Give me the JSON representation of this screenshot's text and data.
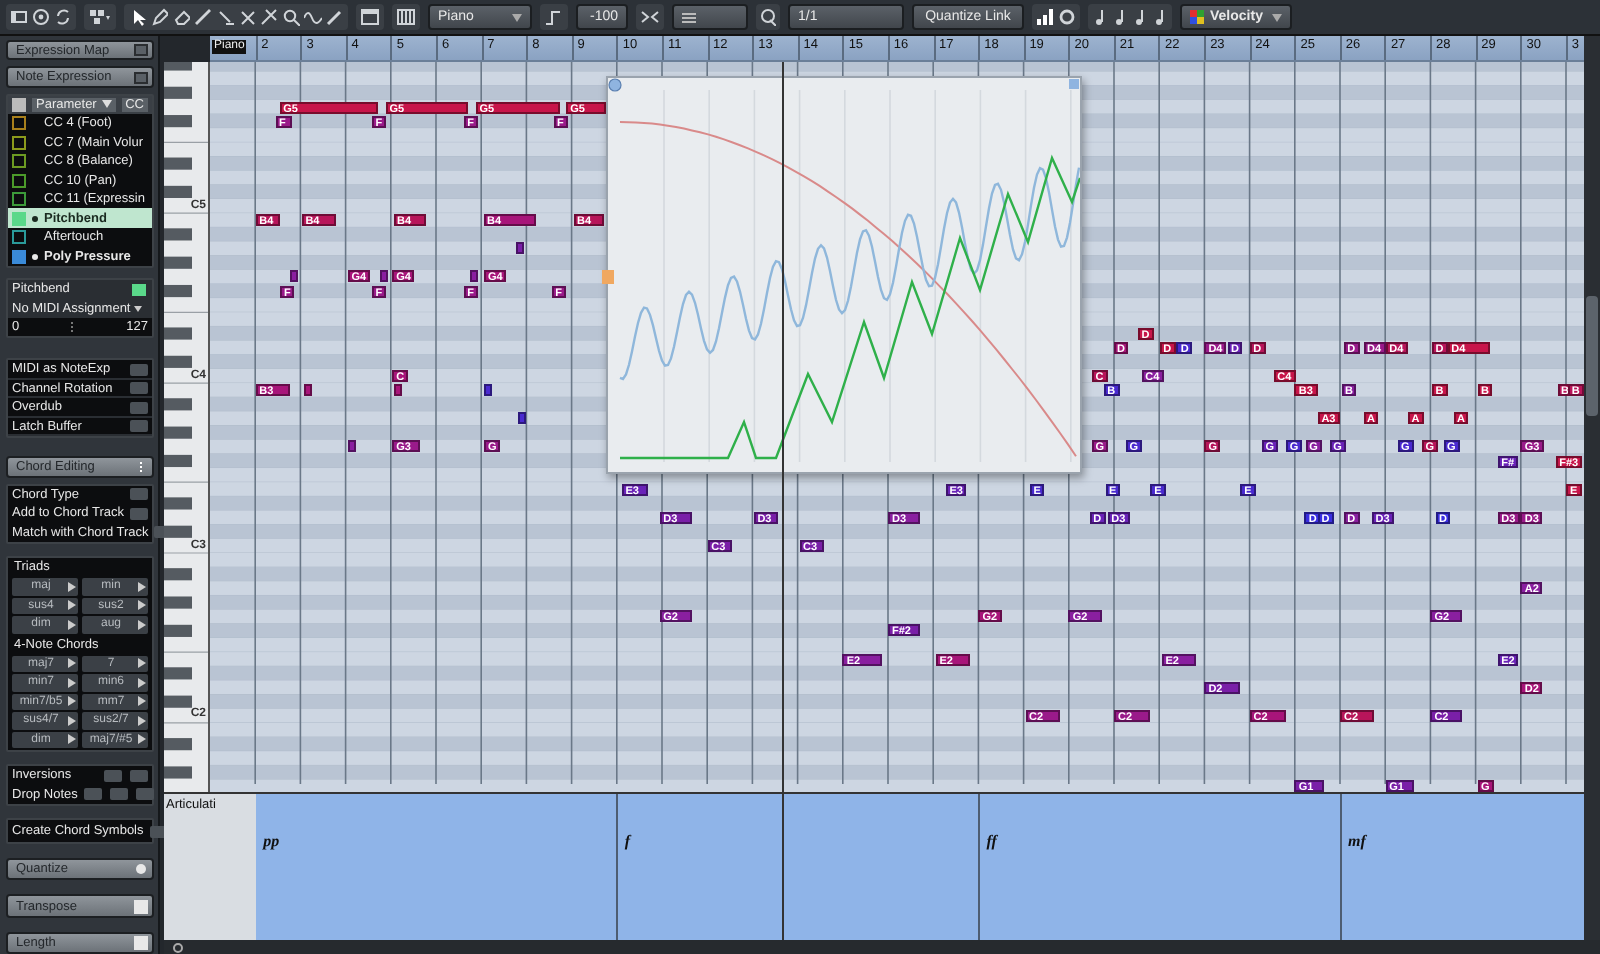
{
  "toolbar": {
    "instrument": "Piano",
    "display": "-100",
    "step": "1/1",
    "quantize": "Quantize Link",
    "color_scheme": "Velocity"
  },
  "inspector": {
    "expression_map": "Expression Map",
    "note_expression": "Note Expression",
    "parameter_header": {
      "checked": true,
      "label": "Parameter",
      "cc": "CC"
    },
    "parameters": [
      {
        "label": "CC 4  (Foot)",
        "color": "#a8801c",
        "active": false,
        "has_data": false,
        "selected": false
      },
      {
        "label": "CC 7  (Main Volur",
        "color": "#8c9a1c",
        "active": false,
        "has_data": false,
        "selected": false
      },
      {
        "label": "CC 8  (Balance)",
        "color": "#6c9a22",
        "active": false,
        "has_data": false,
        "selected": false
      },
      {
        "label": "CC 10  (Pan)",
        "color": "#4c9a2a",
        "active": false,
        "has_data": false,
        "selected": false
      },
      {
        "label": "CC 11  (Expressin",
        "color": "#3c9a3a",
        "active": false,
        "has_data": false,
        "selected": false
      },
      {
        "label": "Pitchbend",
        "color": "#5ad88a",
        "active": true,
        "has_data": true,
        "selected": true
      },
      {
        "label": "Aftertouch",
        "color": "#2a9a9a",
        "active": false,
        "has_data": false,
        "selected": false
      },
      {
        "label": "Poly Pressure",
        "color": "#3a8ad8",
        "active": true,
        "has_data": true,
        "selected": false
      }
    ],
    "pitchbend": {
      "label": "Pitchbend",
      "enabled": true,
      "assignment": "No MIDI Assignment",
      "min": "0",
      "max": "127"
    },
    "options": [
      "MIDI as NoteExp",
      "Channel Rotation",
      "Overdub",
      "Latch Buffer"
    ],
    "chord_editing": "Chord Editing",
    "chord_options": [
      "Chord Type",
      "Add to Chord Track",
      "Match with Chord Track"
    ],
    "triads": {
      "title": "Triads",
      "chords": [
        "maj",
        "min",
        "sus4",
        "sus2",
        "dim",
        "aug"
      ]
    },
    "four_note": {
      "title": "4-Note Chords",
      "chords": [
        "maj7",
        "7",
        "min7",
        "min6",
        "min7/b5",
        "mm7",
        "sus4/7",
        "sus2/7",
        "dim",
        "maj7/#5"
      ]
    },
    "inversions": "Inversions",
    "drop_notes": "Drop Notes",
    "create_symbols": "Create Chord Symbols",
    "sections": [
      "Quantize",
      "Transpose",
      "Length"
    ]
  },
  "editor": {
    "track_label": "Piano",
    "bars": [
      "2",
      "3",
      "4",
      "5",
      "6",
      "7",
      "8",
      "9",
      "10",
      "11",
      "12",
      "13",
      "14",
      "15",
      "16",
      "17",
      "18",
      "19",
      "20",
      "21",
      "22",
      "23",
      "24",
      "25",
      "26",
      "27",
      "28",
      "29",
      "30",
      "3"
    ],
    "octave_labels": [
      "C5",
      "C4",
      "C3",
      "C2"
    ],
    "notes": [
      {
        "label": "G5",
        "color": "#c8154a"
      },
      {
        "label": "G5",
        "color": "#c8154a"
      },
      {
        "label": "G5",
        "color": "#c8154a"
      },
      {
        "label": "G5",
        "color": "#c8154a"
      },
      {
        "label": "F",
        "color": "#9a1a8a"
      },
      {
        "label": "F",
        "color": "#9a1a8a"
      },
      {
        "label": "F",
        "color": "#9a1a8a"
      },
      {
        "label": "F",
        "color": "#9a1a8a"
      },
      {
        "label": "B4",
        "color": "#b8155a"
      },
      {
        "label": "B4",
        "color": "#b8155a"
      },
      {
        "label": "B4",
        "color": "#b8155a"
      },
      {
        "label": "B4",
        "color": "#a8157a"
      },
      {
        "label": "B4",
        "color": "#b8155a"
      },
      {
        "color": "#7a1fa8"
      },
      {
        "label": "G4",
        "color": "#a8157a"
      },
      {
        "label": "G4",
        "color": "#a8157a"
      },
      {
        "label": "G4",
        "color": "#a8157a"
      },
      {
        "color": "#8a1fa0"
      },
      {
        "color": "#8a1fa0"
      },
      {
        "color": "#8a1fa0"
      },
      {
        "label": "F",
        "color": "#9a1a8a"
      },
      {
        "label": "F",
        "color": "#9a1a8a"
      },
      {
        "label": "F",
        "color": "#9a1a8a"
      },
      {
        "label": "F",
        "color": "#9a1a8a"
      },
      {
        "label": "C",
        "color": "#a8157a"
      },
      {
        "label": "B3",
        "color": "#a8157a"
      },
      {
        "color": "#a8157a"
      },
      {
        "color": "#a8157a"
      },
      {
        "color": "#4a2ad0"
      },
      {
        "color": "#4a2ad0"
      },
      {
        "label": "G3",
        "color": "#9a1a8a"
      },
      {
        "label": "G",
        "color": "#9a1a8a"
      },
      {
        "color": "#8a1fa0"
      },
      {
        "label": "D",
        "color": "#c8154a"
      },
      {
        "label": "D",
        "color": "#a8157a"
      },
      {
        "label": "D",
        "color": "#c8154a"
      },
      {
        "label": "D",
        "color": "#4a2ad0"
      },
      {
        "label": "D4",
        "color": "#9a1a8a"
      },
      {
        "label": "D",
        "color": "#6a22b8"
      },
      {
        "label": "D",
        "color": "#b8155a"
      },
      {
        "label": "D",
        "color": "#9a1a8a"
      },
      {
        "label": "D4",
        "color": "#9a1a8a"
      },
      {
        "label": "D4",
        "color": "#b8155a"
      },
      {
        "label": "D",
        "color": "#b8155a"
      },
      {
        "label": "D4",
        "color": "#c8154a"
      },
      {
        "label": "C",
        "color": "#b8155a"
      },
      {
        "label": "C4",
        "color": "#8a1fa0"
      },
      {
        "label": "C4",
        "color": "#c8154a"
      },
      {
        "label": "B",
        "color": "#4a2ad0"
      },
      {
        "label": "B3",
        "color": "#c8154a"
      },
      {
        "label": "B",
        "color": "#8a1fa0"
      },
      {
        "label": "B",
        "color": "#c8154a"
      },
      {
        "label": "B",
        "color": "#c8154a"
      },
      {
        "label": "B",
        "color": "#b8155a"
      },
      {
        "label": "B",
        "color": "#b8155a"
      },
      {
        "label": "A3",
        "color": "#c8154a"
      },
      {
        "label": "A",
        "color": "#c8154a"
      },
      {
        "label": "A",
        "color": "#c8154a"
      },
      {
        "label": "A",
        "color": "#c8154a"
      },
      {
        "label": "G",
        "color": "#9a1a8a"
      },
      {
        "label": "G",
        "color": "#4a2ad0"
      },
      {
        "label": "G",
        "color": "#b8155a"
      },
      {
        "label": "G",
        "color": "#6a22b8"
      },
      {
        "label": "G",
        "color": "#4a2ad0"
      },
      {
        "label": "G",
        "color": "#8a1fa0"
      },
      {
        "label": "G",
        "color": "#6a22b8"
      },
      {
        "label": "G",
        "color": "#4a2ad0"
      },
      {
        "label": "G",
        "color": "#b8155a"
      },
      {
        "label": "G",
        "color": "#4a2ad0"
      },
      {
        "label": "G3",
        "color": "#9a1a8a"
      },
      {
        "label": "F#",
        "color": "#6a22b8"
      },
      {
        "label": "F#3",
        "color": "#c8154a"
      },
      {
        "label": "E3",
        "color": "#6a22b8"
      },
      {
        "label": "E3",
        "color": "#6a22b8"
      },
      {
        "label": "E",
        "color": "#4a2ad0"
      },
      {
        "label": "E",
        "color": "#4a2ad0"
      },
      {
        "label": "E",
        "color": "#4a2ad0"
      },
      {
        "label": "E",
        "color": "#4a2ad0"
      },
      {
        "label": "E",
        "color": "#c8154a"
      },
      {
        "label": "D3",
        "color": "#7a1fa8"
      },
      {
        "label": "D3",
        "color": "#7a1fa8"
      },
      {
        "label": "D3",
        "color": "#8a1fa0"
      },
      {
        "label": "D",
        "color": "#6a22b8"
      },
      {
        "label": "D3",
        "color": "#6a22b8"
      },
      {
        "label": "D",
        "color": "#3a2ee0"
      },
      {
        "label": "D",
        "color": "#3a2ee0"
      },
      {
        "label": "D",
        "color": "#8a1fa0"
      },
      {
        "label": "D3",
        "color": "#6a22b8"
      },
      {
        "label": "D",
        "color": "#3a2ee0"
      },
      {
        "label": "D3",
        "color": "#9a1a8a"
      },
      {
        "label": "D3",
        "color": "#9a1a8a"
      },
      {
        "label": "C3",
        "color": "#7a1fa8"
      },
      {
        "label": "C3",
        "color": "#7a1fa8"
      },
      {
        "label": "A2",
        "color": "#8a1fa0"
      },
      {
        "label": "G2",
        "color": "#8a1fa0"
      },
      {
        "label": "G2",
        "color": "#a8157a"
      },
      {
        "label": "G2",
        "color": "#8a1fa0"
      },
      {
        "label": "G2",
        "color": "#8a1fa0"
      },
      {
        "label": "F#2",
        "color": "#7a1fa8"
      },
      {
        "label": "E2",
        "color": "#8a1fa0"
      },
      {
        "label": "E2",
        "color": "#a8157a"
      },
      {
        "label": "E2",
        "color": "#8a1fa0"
      },
      {
        "label": "E2",
        "color": "#6a22b8"
      },
      {
        "label": "D2",
        "color": "#7a1fa8"
      },
      {
        "label": "D2",
        "color": "#a8157a"
      },
      {
        "label": "C2",
        "color": "#9a1a8a"
      },
      {
        "label": "C2",
        "color": "#9a1a8a"
      },
      {
        "label": "C2",
        "color": "#a8157a"
      },
      {
        "label": "C2",
        "color": "#b8155a"
      },
      {
        "label": "C2",
        "color": "#7a1fa8"
      },
      {
        "label": "G1",
        "color": "#7a1fa8"
      },
      {
        "label": "G1",
        "color": "#7a1fa8"
      },
      {
        "label": "G",
        "color": "#a8157a"
      }
    ],
    "articulation_lane": {
      "label": "Articulati",
      "dynamics": [
        "pp",
        "f",
        "ff",
        "mf"
      ]
    }
  }
}
